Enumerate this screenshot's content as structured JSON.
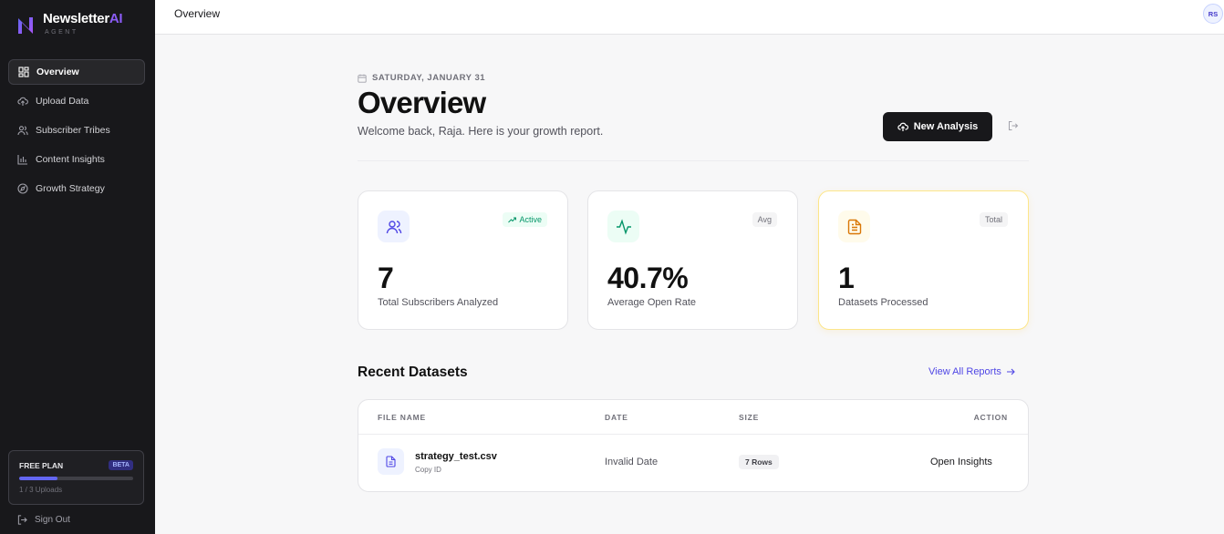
{
  "brand": {
    "name_main": "Newsletter",
    "name_accent": "AI",
    "subtitle": "AGENT"
  },
  "sidebar": {
    "items": [
      {
        "label": "Overview",
        "icon": "layout-grid-icon",
        "active": true
      },
      {
        "label": "Upload Data",
        "icon": "upload-cloud-icon",
        "active": false
      },
      {
        "label": "Subscriber Tribes",
        "icon": "users-icon",
        "active": false
      },
      {
        "label": "Content Insights",
        "icon": "bar-chart-icon",
        "active": false
      },
      {
        "label": "Growth Strategy",
        "icon": "compass-icon",
        "active": false
      }
    ],
    "plan": {
      "label": "FREE PLAN",
      "badge": "BETA",
      "usage_text": "1 / 3 Uploads",
      "usage_fraction": 0.333
    },
    "sign_out": "Sign Out"
  },
  "topbar": {
    "title": "Overview",
    "avatar_initials": "RS"
  },
  "header": {
    "date": "SATURDAY, JANUARY 31",
    "title": "Overview",
    "welcome": "Welcome back, Raja. Here is your growth report.",
    "new_button": "New Analysis"
  },
  "stats": [
    {
      "value": "7",
      "label": "Total Subscribers Analyzed",
      "badge": "Active",
      "icon": "users-icon",
      "color": "#4f46e5"
    },
    {
      "value": "40.7%",
      "label": "Average Open Rate",
      "badge": "Avg",
      "icon": "activity-icon",
      "color": "#059669"
    },
    {
      "value": "1",
      "label": "Datasets Processed",
      "badge": "Total",
      "icon": "file-text-icon",
      "color": "#d97706"
    }
  ],
  "recent": {
    "title": "Recent Datasets",
    "view_all": "View All Reports",
    "columns": [
      "FILE NAME",
      "DATE",
      "SIZE",
      "ACTION"
    ],
    "rows": [
      {
        "file_name": "strategy_test.csv",
        "sub": "Copy ID",
        "date": "Invalid Date",
        "size": "7 Rows",
        "action": "Open Insights"
      }
    ]
  },
  "colors": {
    "sidebar_bg": "#18181b",
    "accent": "#6366f1",
    "page_bg": "#f7f7f8"
  }
}
